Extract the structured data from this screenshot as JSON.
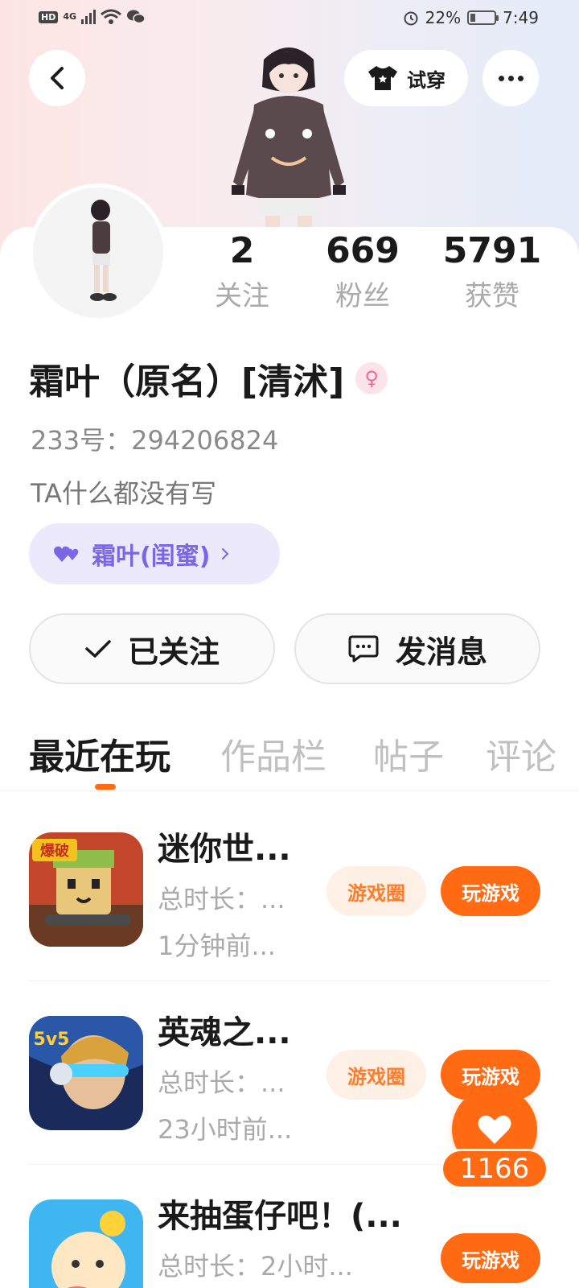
{
  "status_bar": {
    "hd": "HD",
    "network": "4G",
    "battery": "22%",
    "battery_level": 0.22,
    "time": "7:49"
  },
  "header": {
    "try_on_label": "试穿"
  },
  "stats": [
    {
      "value": "2",
      "label": "关注"
    },
    {
      "value": "669",
      "label": "粉丝"
    },
    {
      "value": "5791",
      "label": "获赞"
    }
  ],
  "profile": {
    "username": "霜叶（原名）[清沭]",
    "gender": "female",
    "uid": "233号：294206824",
    "bio": "TA什么都没有写",
    "relation_tag": "霜叶(闺蜜)"
  },
  "actions": {
    "follow_label": "已关注",
    "message_label": "发消息"
  },
  "tabs": [
    {
      "label": "最近在玩"
    },
    {
      "label": "作品栏"
    },
    {
      "label": "帖子"
    },
    {
      "label": "评论"
    }
  ],
  "games": [
    {
      "name": "迷你世...",
      "duration": "总时长：...",
      "last_played": "1分钟前...",
      "badge": "爆破",
      "circle_label": "游戏圈",
      "play_label": "玩游戏"
    },
    {
      "name": "英魂之...",
      "duration": "总时长：...",
      "last_played": "23小时前...",
      "badge": "5v5",
      "circle_label": "游戏圈",
      "play_label": "玩游戏"
    },
    {
      "name": "来抽蛋仔吧！(...",
      "duration": "总时长：2小时...",
      "last_played": "",
      "badge": "",
      "circle_label": "",
      "play_label": "玩游戏"
    }
  ],
  "like_fab": {
    "count": "1166"
  },
  "colors": {
    "accent": "#ff6a13",
    "relation_purple": "#7b66e6",
    "gender_pink": "#f06a93"
  }
}
